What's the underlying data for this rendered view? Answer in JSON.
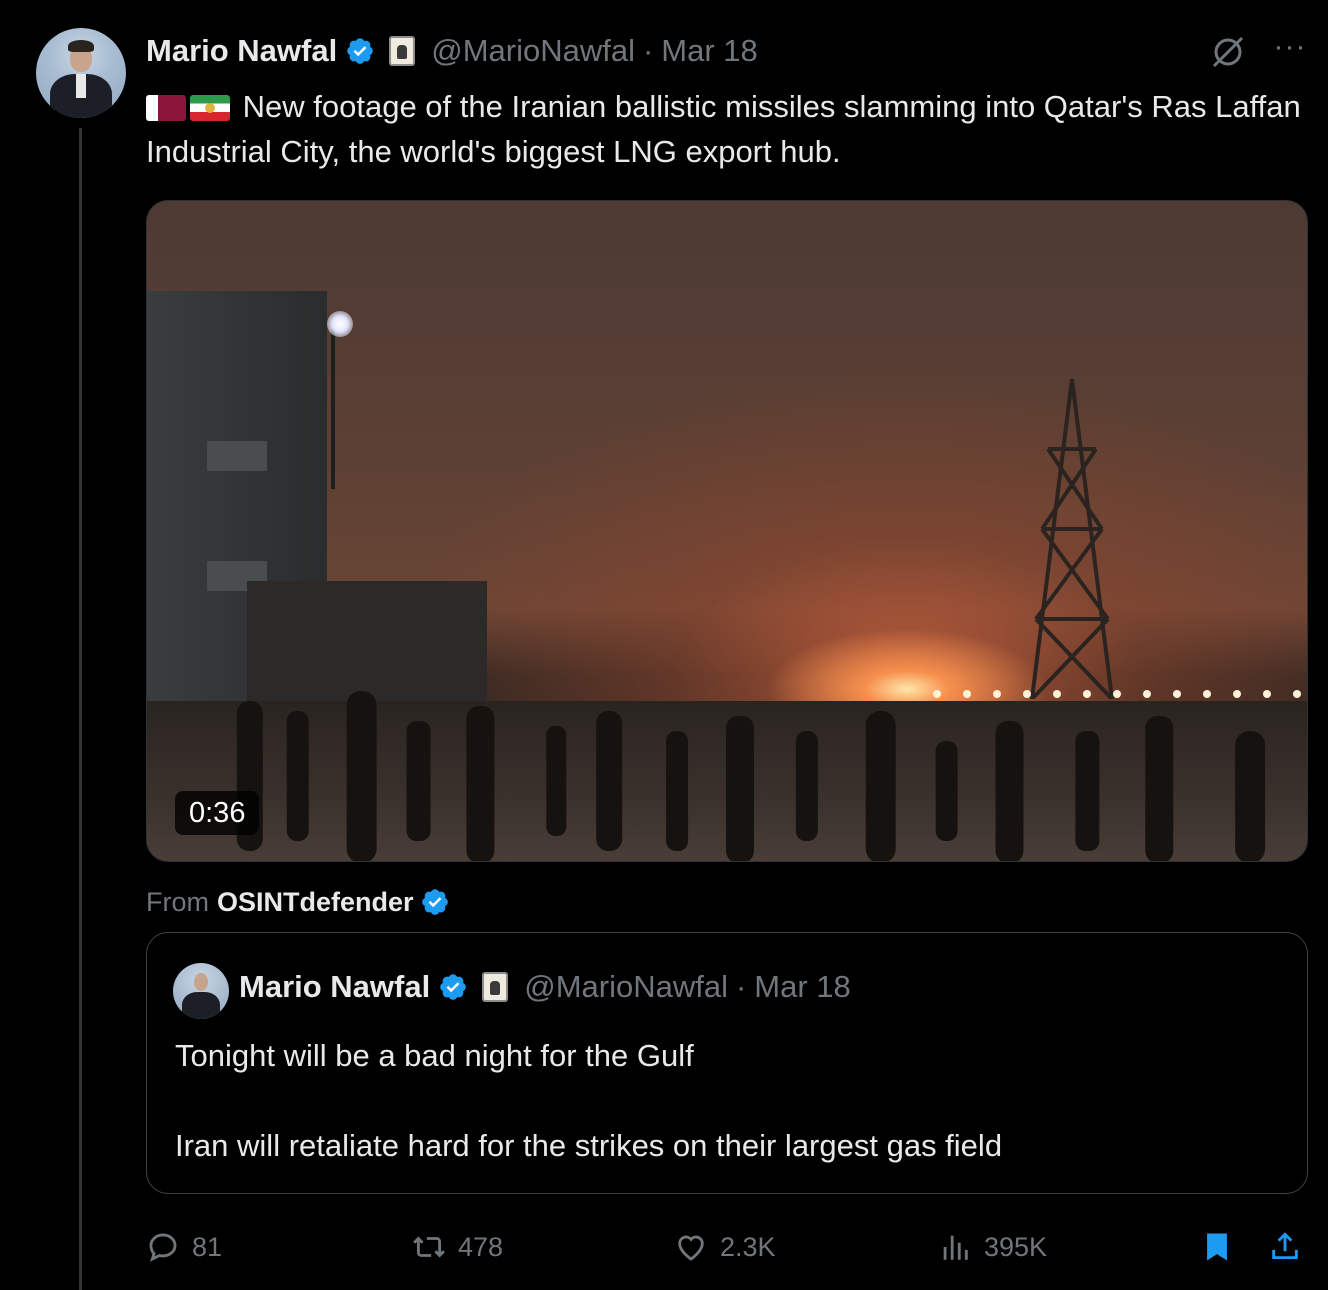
{
  "tweet": {
    "author_name": "Mario Nawfal",
    "handle": "@MarioNawfal",
    "separator": "·",
    "date": "Mar 18",
    "more_label": "···",
    "text": "New footage of the Iranian ballistic missiles slamming into Qatar's Ras Laffan Industrial City, the world's biggest LNG export hub.",
    "flags": [
      "qatar-flag",
      "iran-flag"
    ]
  },
  "media": {
    "duration": "0:36"
  },
  "attribution": {
    "prefix": "From",
    "source": "OSINTdefender"
  },
  "quote": {
    "author_name": "Mario Nawfal",
    "handle": "@MarioNawfal",
    "separator": "·",
    "date": "Mar 18",
    "line1": "Tonight will be a bad night for the Gulf",
    "line2": "Iran will retaliate hard for the strikes on their largest gas field"
  },
  "actions": {
    "replies": "81",
    "reposts": "478",
    "likes": "2.3K",
    "views": "395K"
  },
  "colors": {
    "background": "#000000",
    "text": "#e7e9ea",
    "muted": "#71767b",
    "verified": "#1d9bf0",
    "bookmark": "#1d9bf0"
  }
}
